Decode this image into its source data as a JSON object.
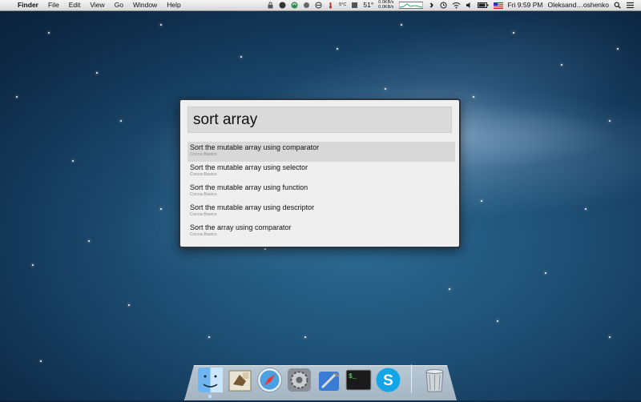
{
  "menubar": {
    "apple": "",
    "app": "Finder",
    "menus": [
      "File",
      "Edit",
      "View",
      "Go",
      "Window",
      "Help"
    ],
    "status": {
      "temp_label": "5°C",
      "cpu_temp": "51°",
      "net_up": "0.0KB/s",
      "net_down": "0.0KB/s",
      "time": "Fri 9:59 PM",
      "user": "Oleksand…oshenko"
    },
    "colors": {
      "bar_top": "#f4f4f4",
      "bar_bottom": "#d9d9d9"
    }
  },
  "spotlight": {
    "query": "sort array",
    "results": [
      {
        "title": "Sort the mutable array using comparator",
        "subtitle": "Cocoa Basics",
        "selected": true
      },
      {
        "title": "Sort the mutable array using selector",
        "subtitle": "Cocoa Basics",
        "selected": false
      },
      {
        "title": "Sort the mutable array using function",
        "subtitle": "Cocoa Basics",
        "selected": false
      },
      {
        "title": "Sort the mutable array using descriptor",
        "subtitle": "Cocoa Basics",
        "selected": false
      },
      {
        "title": "Sort the array using comparator",
        "subtitle": "Cocoa Basics",
        "selected": false
      }
    ]
  },
  "dock": {
    "items": [
      {
        "icon": "finder-icon"
      },
      {
        "icon": "mail-icon"
      },
      {
        "icon": "safari-icon"
      },
      {
        "icon": "system-preferences-icon"
      },
      {
        "icon": "xcode-icon"
      },
      {
        "icon": "terminal-icon",
        "label": "$_"
      },
      {
        "icon": "skype-icon",
        "label": "S"
      },
      {
        "icon": "trash-icon"
      }
    ]
  }
}
